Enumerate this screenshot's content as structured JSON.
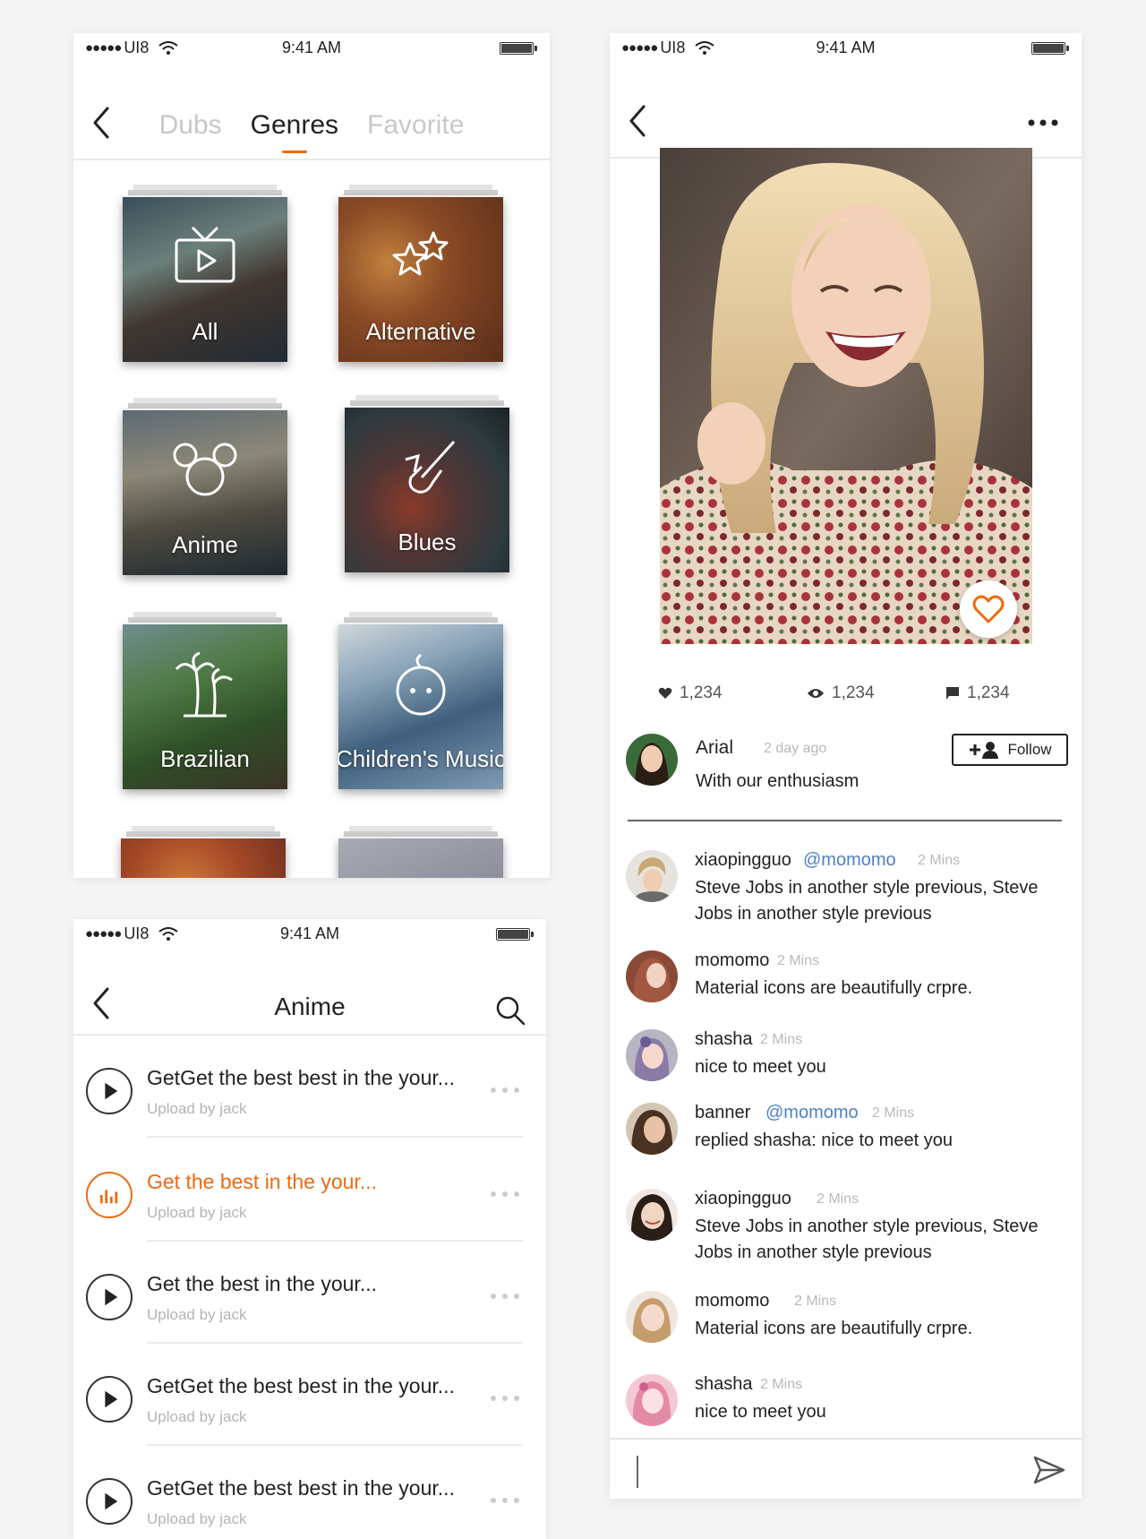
{
  "status_bar": {
    "carrier": "UI8",
    "signal_dots": "●●●●●",
    "time": "9:41 AM"
  },
  "genres_screen": {
    "tabs": [
      {
        "label": "Dubs"
      },
      {
        "label": "Genres"
      },
      {
        "label": "Favorite"
      }
    ],
    "active_tab": "Genres",
    "genres": [
      {
        "label": "All",
        "icon": "tv-play-icon"
      },
      {
        "label": "Alternative",
        "icon": "stars-icon"
      },
      {
        "label": "Anime",
        "icon": "mouse-ears-icon"
      },
      {
        "label": "Blues",
        "icon": "saxophone-icon"
      },
      {
        "label": "Brazilian",
        "icon": "palm-trees-icon"
      },
      {
        "label": "Children's Music",
        "icon": "baby-face-icon"
      },
      {
        "label": "",
        "icon": "pagoda-icon"
      },
      {
        "label": "",
        "icon": "heart-plus-icon"
      }
    ]
  },
  "anime_screen": {
    "title": "Anime",
    "tracks": [
      {
        "title": "GetGet the best best in the your...",
        "uploader": "Upload by jack",
        "state": "paused"
      },
      {
        "title": "Get the best in the your...",
        "uploader": "Upload by jack",
        "state": "playing"
      },
      {
        "title": "Get the best in the your...",
        "uploader": "Upload by jack",
        "state": "paused"
      },
      {
        "title": "GetGet the best best in the your...",
        "uploader": "Upload by jack",
        "state": "paused"
      },
      {
        "title": "GetGet the best best in the your...",
        "uploader": "Upload by jack",
        "state": "paused"
      }
    ]
  },
  "post_screen": {
    "stats": {
      "likes": "1,234",
      "views": "1,234",
      "comments": "1,234"
    },
    "author": {
      "name": "Arial",
      "time": "2 day ago",
      "caption": "With our enthusiasm"
    },
    "follow_label": "Follow",
    "comments": [
      {
        "name": "xiaopingguo",
        "mention": "@momomo",
        "time": "2 Mins",
        "text": "Steve Jobs in another style previous, Steve Jobs in another style previous"
      },
      {
        "name": "momomo",
        "mention": "",
        "time": "2 Mins",
        "text": "Material icons are beautifully crpre."
      },
      {
        "name": "shasha",
        "mention": "",
        "time": "2 Mins",
        "text": "nice to meet you"
      },
      {
        "name": "banner",
        "mention": "@momomo",
        "time": "2 Mins",
        "text": "replied shasha: nice to meet you"
      },
      {
        "name": "xiaopingguo",
        "mention": "",
        "time": "2 Mins",
        "text": "Steve Jobs in another style previous, Steve Jobs in another style previous"
      },
      {
        "name": "momomo",
        "mention": "",
        "time": "2 Mins",
        "text": "Material icons are beautifully crpre."
      },
      {
        "name": "shasha",
        "mention": "",
        "time": "2 Mins",
        "text": "nice to meet you"
      }
    ],
    "composer_placeholder": ""
  },
  "colors": {
    "accent": "#ee6a10",
    "mention": "#4f7fc7",
    "muted_text": "#b4b4b4",
    "divider": "#e9e9e9",
    "background": "#f4f4f4"
  },
  "icons": {
    "back": "chevron-left-icon",
    "search": "search-icon",
    "more": "more-dots-icon",
    "like": "heart-outline-icon",
    "send": "send-icon",
    "follow": "add-person-icon",
    "play": "play-icon",
    "equalizer": "equalizer-icon",
    "wifi": "wifi-icon",
    "battery": "battery-icon",
    "views": "eye-icon",
    "comment": "comment-icon"
  }
}
